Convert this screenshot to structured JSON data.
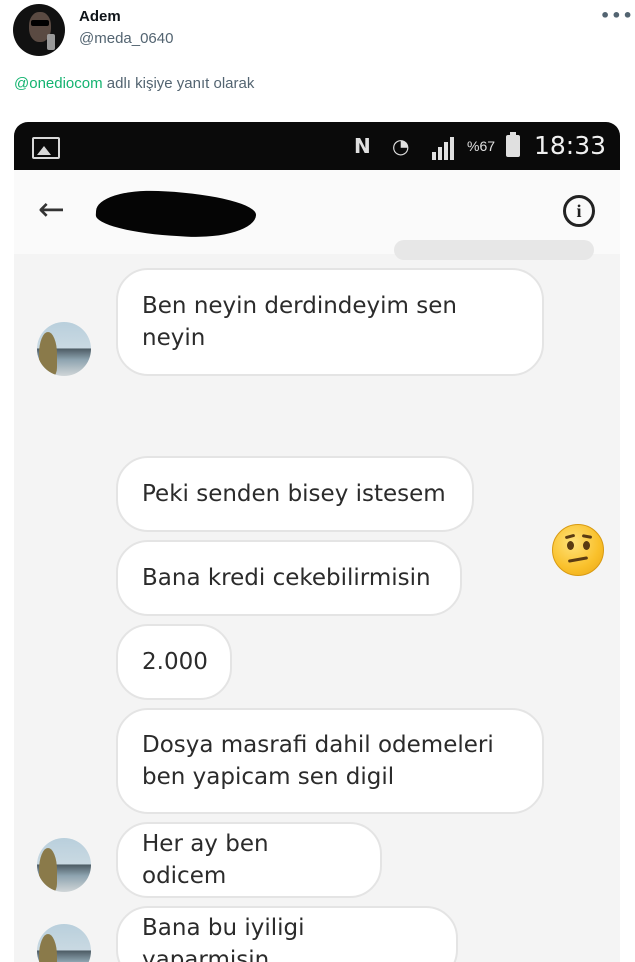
{
  "tweet": {
    "author_name": "Adem",
    "author_handle": "@meda_0640",
    "more_glyph": "•••",
    "reply_mention": "@onediocom",
    "reply_suffix": " adlı kişiye yanıt olarak"
  },
  "phone": {
    "status_bar": {
      "battery_percent": "%67",
      "time": "18:33",
      "icons": [
        "gallery-icon",
        "nfc-icon",
        "wifi-icon",
        "signal-icon",
        "battery-charging-icon"
      ]
    },
    "chat_header": {
      "back_glyph": "←",
      "info_glyph": "i",
      "contact_name": ""
    },
    "messages": [
      {
        "sender": "contact",
        "text": "Ben neyin derdindeyim sen neyin"
      },
      {
        "sender": "self",
        "emoji": "confused-face"
      },
      {
        "sender": "contact",
        "text": "Peki senden bisey istesem"
      },
      {
        "sender": "contact",
        "text": "Bana kredi cekebilirmisin"
      },
      {
        "sender": "contact",
        "text": "2.000"
      },
      {
        "sender": "contact",
        "text": "Dosya masrafi dahil odemeleri ben yapicam sen digil"
      },
      {
        "sender": "contact",
        "text": "Her ay ben odicem"
      },
      {
        "sender": "contact",
        "text": "Bana bu iyiligi yaparmisin"
      }
    ]
  }
}
